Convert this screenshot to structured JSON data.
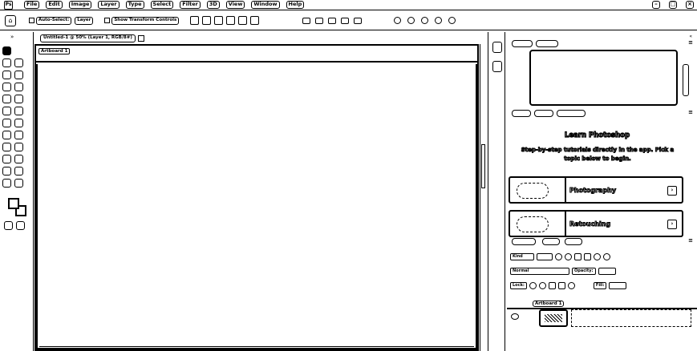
{
  "app": {
    "logo": "Ps",
    "menu": [
      "File",
      "Edit",
      "Image",
      "Layer",
      "Type",
      "Select",
      "Filter",
      "3D",
      "View",
      "Window",
      "Help"
    ],
    "window_controls": [
      "minimize",
      "maximize",
      "close"
    ]
  },
  "options_bar": {
    "auto_select_label": "Auto-Select:",
    "layer_label": "Layer",
    "transform_label": "Show Transform Controls"
  },
  "document": {
    "tab_title": "Untitled-1 @ 50% (Layer 1, RGB/8#)",
    "artboard_label": "Artboard 1"
  },
  "learn_panel": {
    "title": "Learn Photoshop",
    "subtitle": "Step-by-step tutorials directly in the app. Pick a topic below to begin.",
    "cards": [
      {
        "label": "Photography"
      },
      {
        "label": "Retouching"
      }
    ]
  },
  "layers_panel": {
    "kind_filter": "Kind",
    "blend_mode": "Normal",
    "opacity_label": "Opacity:",
    "lock_label": "Lock:",
    "fill_label": "Fill:",
    "artboard_layer": "Artboard 1"
  },
  "colors": {
    "ink": "#000000",
    "paper": "#ffffff"
  }
}
